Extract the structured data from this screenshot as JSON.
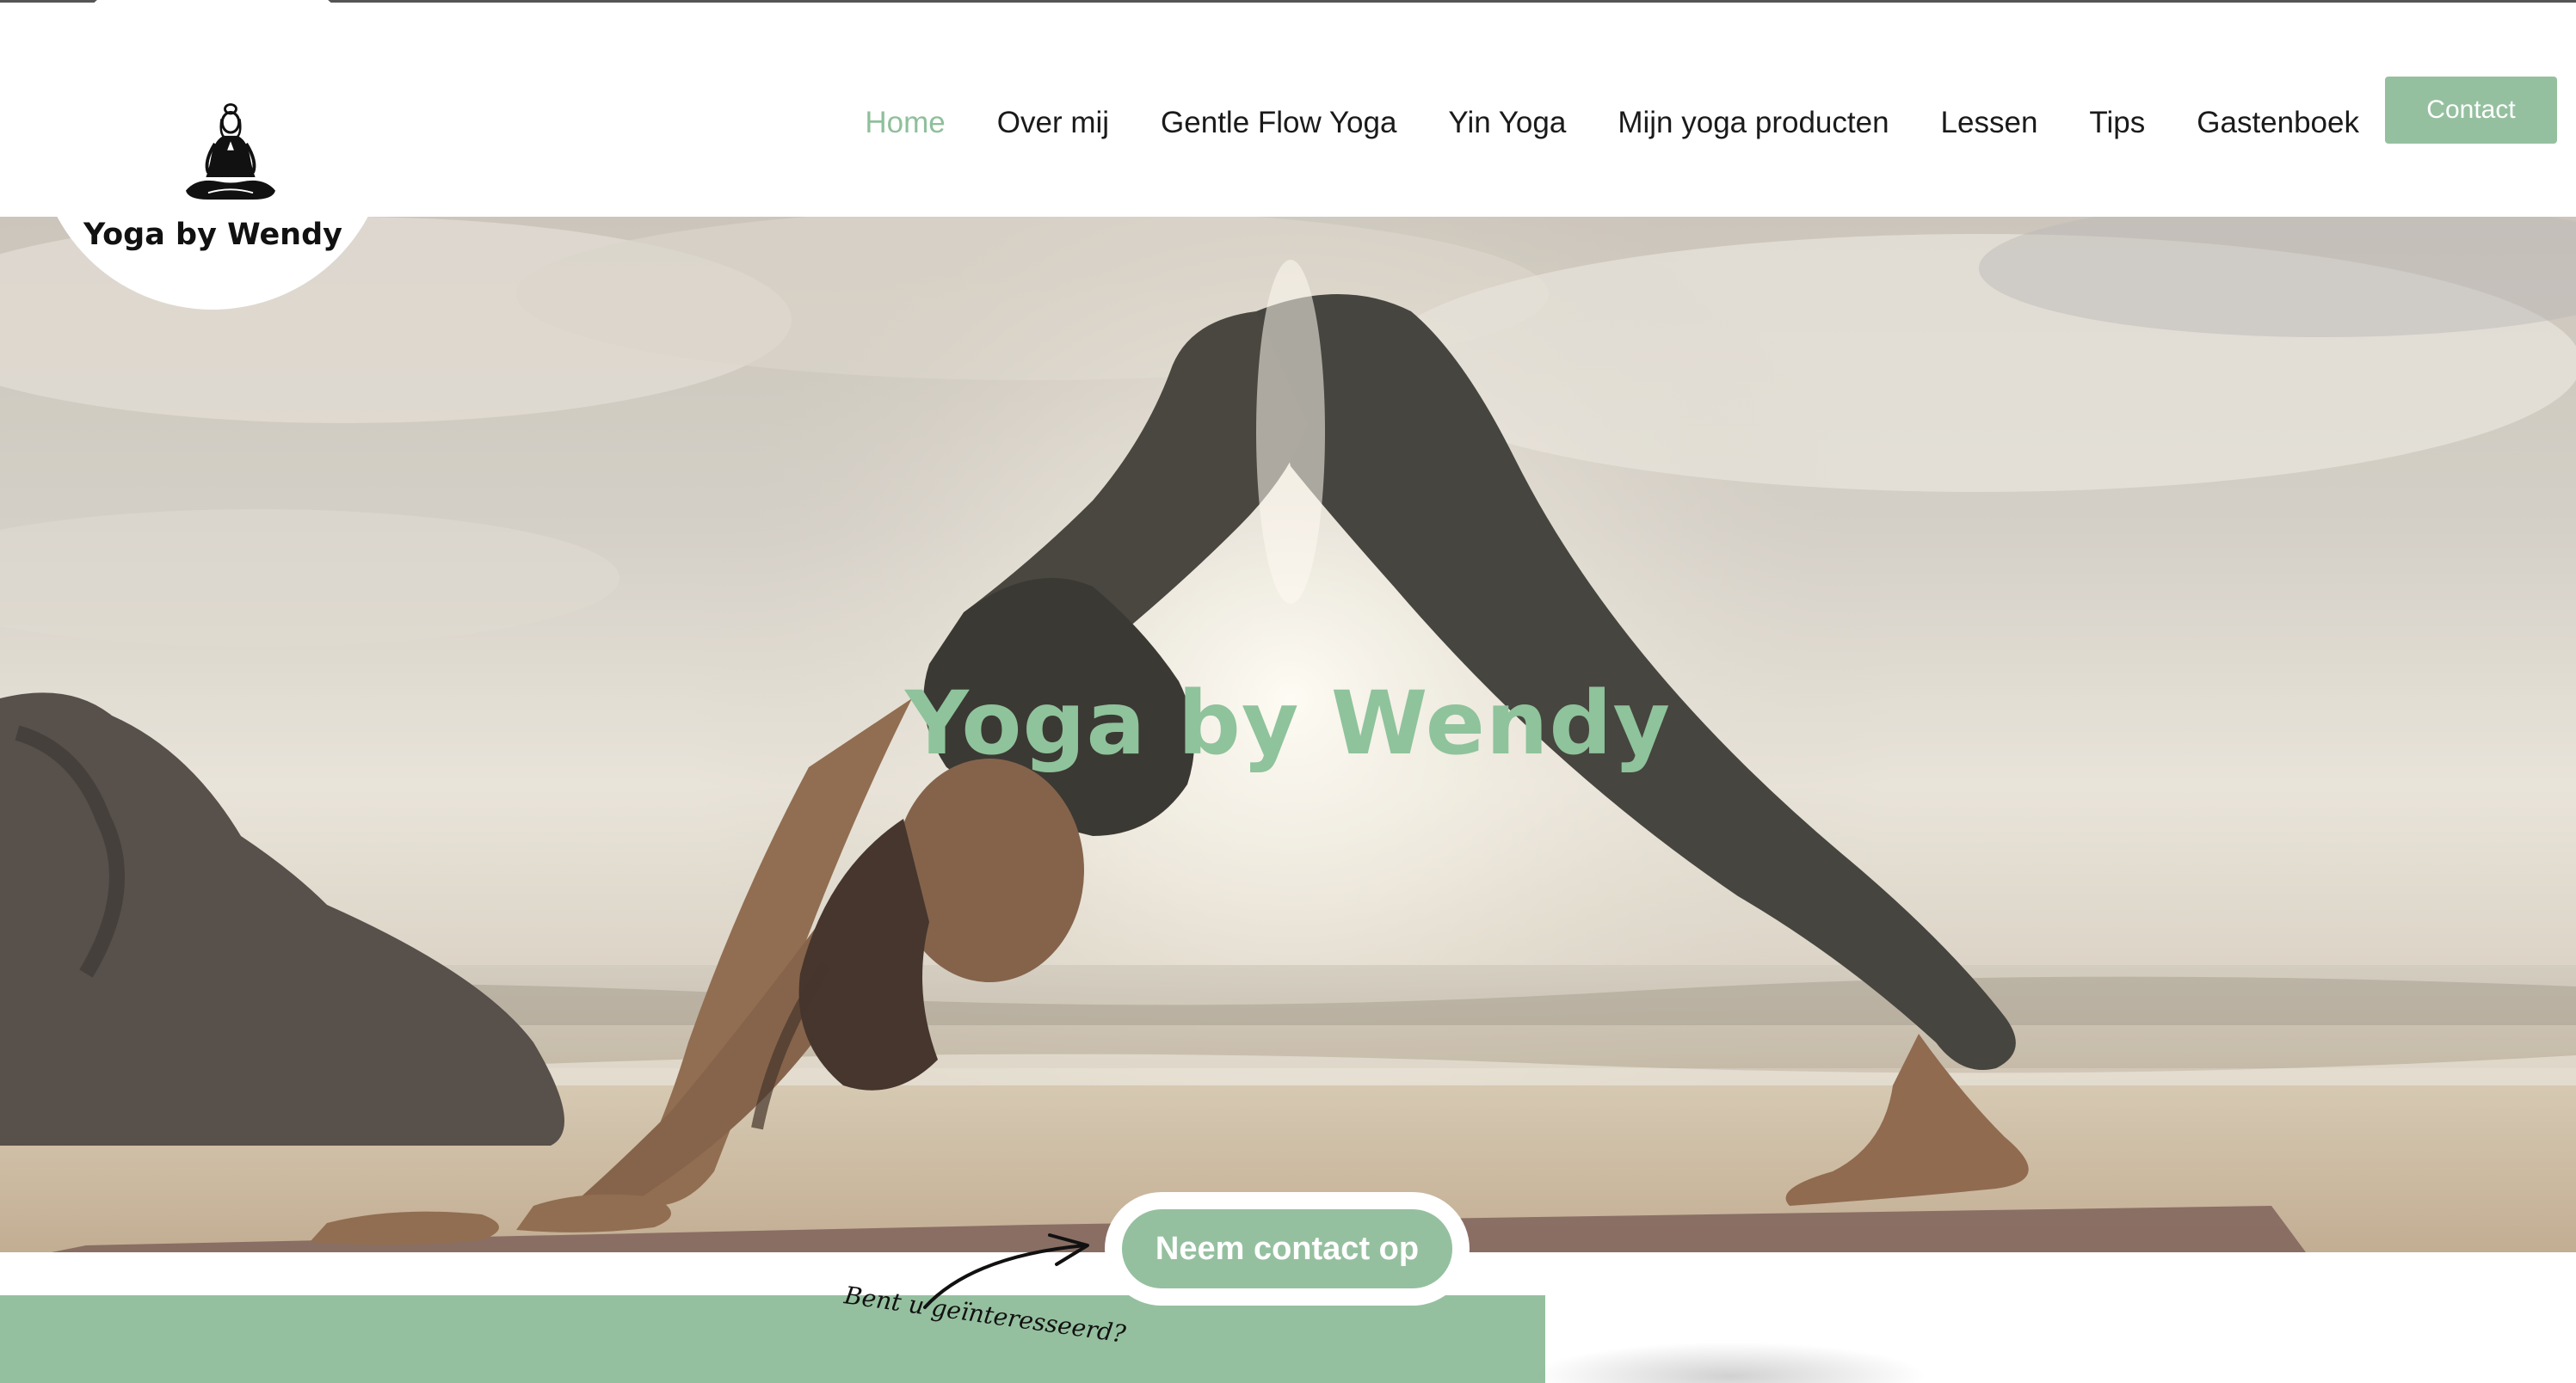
{
  "brand": {
    "name": "Yoga by Wendy",
    "logo_icon": "meditating-woman-icon"
  },
  "nav": {
    "items": [
      {
        "label": "Home",
        "active": true
      },
      {
        "label": "Over mij",
        "active": false
      },
      {
        "label": "Gentle Flow Yoga",
        "active": false
      },
      {
        "label": "Yin Yoga",
        "active": false
      },
      {
        "label": "Mijn yoga producten",
        "active": false
      },
      {
        "label": "Lessen",
        "active": false
      },
      {
        "label": "Tips",
        "active": false
      },
      {
        "label": "Gastenboek",
        "active": false
      }
    ],
    "contact_label": "Contact"
  },
  "hero": {
    "title": "Yoga by Wendy",
    "cta_label": "Neem contact op",
    "note": "Bent u geïnteresseerd?"
  },
  "colors": {
    "accent": "#95c09f",
    "active_nav": "#8fbf9c",
    "hero_title": "#8fc39b"
  }
}
